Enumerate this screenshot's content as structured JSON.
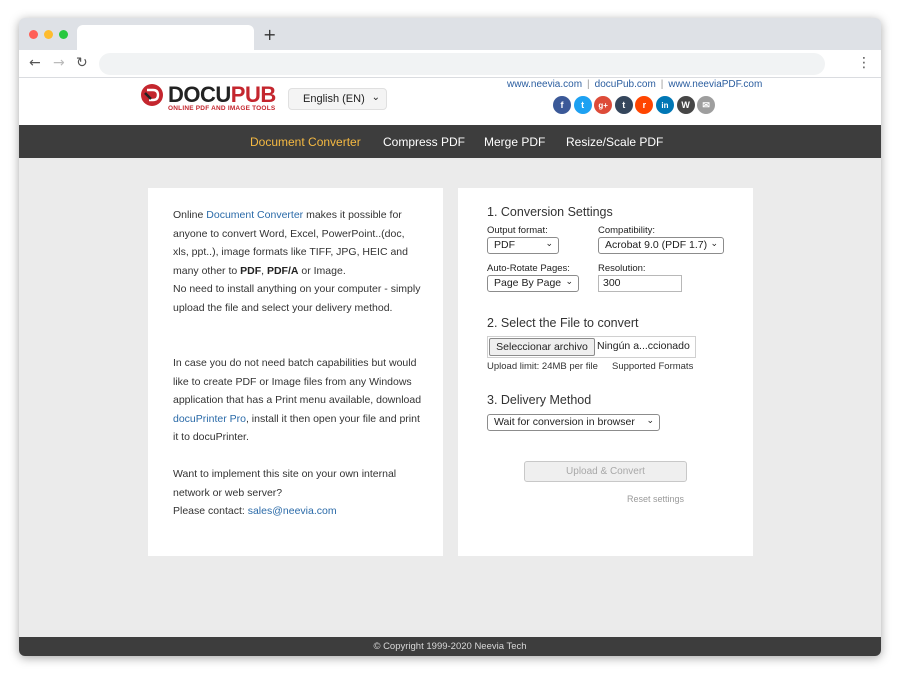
{
  "browser": {
    "window_controls": {
      "close_color": "#ff5f57",
      "minimize_color": "#febc2e",
      "maximize_color": "#28c840"
    },
    "new_tab_label": "+",
    "menu_glyph": "⋮"
  },
  "header": {
    "logo_docu": "DOCU",
    "logo_pub": "PUB",
    "logo_tagline": "ONLINE PDF AND IMAGE TOOLS",
    "language": "English (EN)",
    "links": [
      "www.neevia.com",
      "docuPub.com",
      "www.neeviaPDF.com"
    ],
    "separator": "|",
    "social": [
      {
        "name": "facebook-icon",
        "glyph": "f",
        "color": "#3b5998"
      },
      {
        "name": "twitter-icon",
        "glyph": "t",
        "color": "#1da1f2"
      },
      {
        "name": "google-plus-icon",
        "glyph": "g+",
        "color": "#dd4b39"
      },
      {
        "name": "tumblr-icon",
        "glyph": "t",
        "color": "#35465c"
      },
      {
        "name": "reddit-icon",
        "glyph": "r",
        "color": "#ff4500"
      },
      {
        "name": "linkedin-icon",
        "glyph": "in",
        "color": "#0077b5"
      },
      {
        "name": "wordpress-icon",
        "glyph": "W",
        "color": "#464646"
      },
      {
        "name": "email-icon",
        "glyph": "✉",
        "color": "#9e9e9e"
      }
    ]
  },
  "menu": {
    "items": [
      "Document Converter",
      "Compress PDF",
      "Merge PDF",
      "Resize/Scale PDF"
    ],
    "active_color": "#f5b942"
  },
  "left_panel": {
    "p1_a": "Online ",
    "p1_link": "Document Converter",
    "p1_b": " makes it possible for anyone to convert Word, Excel, PowerPoint..(doc, xls, ppt..), image formats like TIFF, JPG, HEIC and many other to ",
    "p1_bold1": "PDF",
    "p1_comma": ", ",
    "p1_bold2": "PDF/A",
    "p1_c": " or Image.",
    "p1_d": "No need to install anything on your computer - simply upload the file and select your delivery method.",
    "p2_a": "In case you do not need batch capabilities but would like to create PDF or Image files from any Windows application that has a Print menu available, download ",
    "p2_link": "docuPrinter Pro",
    "p2_b": ", install it then open your file and print it to docuPrinter.",
    "p3_a": "Want to implement this site on your own internal network or web server?",
    "p3_b": "Please contact: ",
    "p3_link": "sales@neevia.com"
  },
  "right_panel": {
    "sec1_title": "1. Conversion Settings",
    "output_format_label": "Output format:",
    "output_format_value": "PDF",
    "compat_label": "Compatibility:",
    "compat_value": "Acrobat 9.0 (PDF 1.7)",
    "autorotate_label": "Auto-Rotate Pages:",
    "autorotate_value": "Page By Page",
    "resolution_label": "Resolution:",
    "resolution_value": "300",
    "sec2_title": "2. Select the File to convert",
    "file_button": "Seleccionar archivo",
    "file_status": "Ningún a...ccionado",
    "upload_limit": "Upload limit: 24MB per file",
    "supported_formats": "Supported Formats",
    "sec3_title": "3. Delivery Method",
    "delivery_value": "Wait for conversion in browser",
    "upload_button": "Upload & Convert",
    "reset": "Reset settings"
  },
  "footer": {
    "copyright": "© Copyright 1999-2020 Neevia Tech"
  }
}
